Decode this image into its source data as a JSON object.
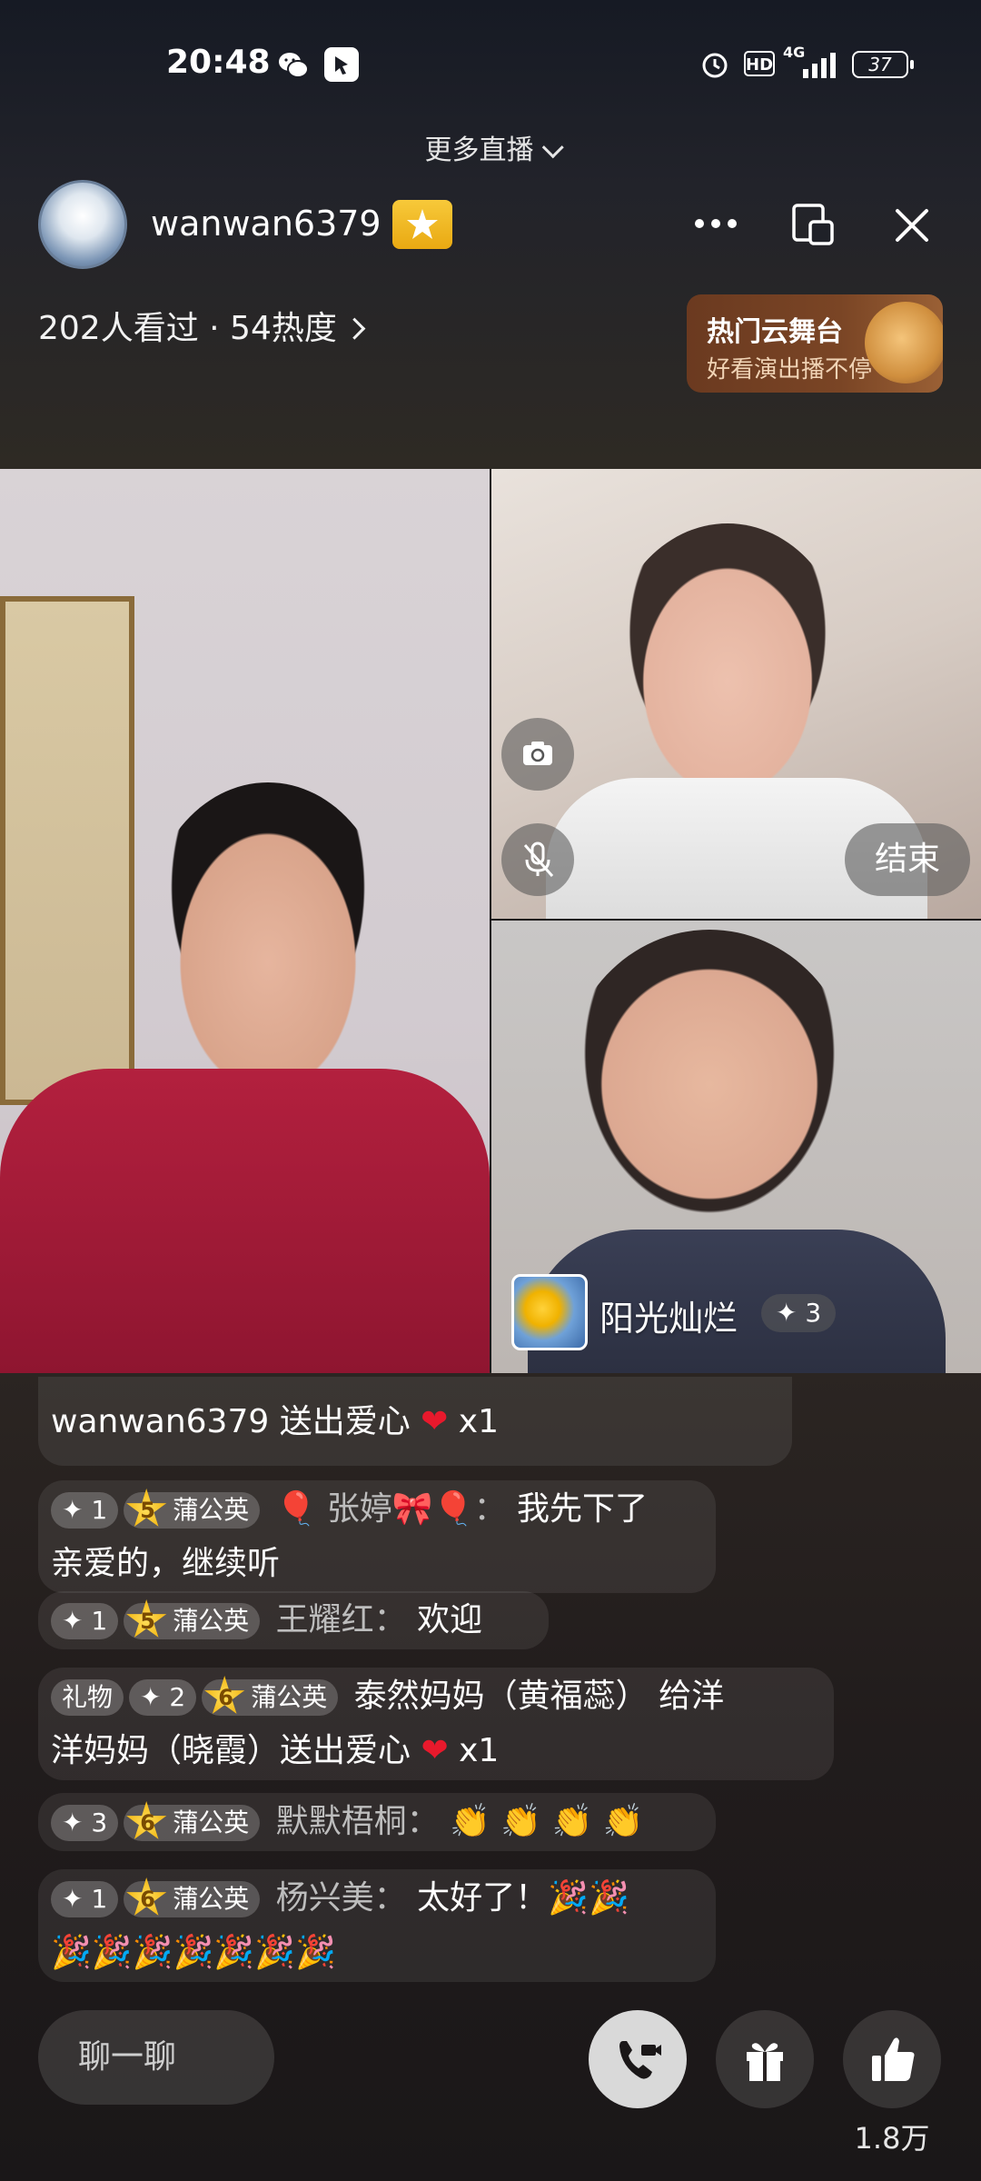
{
  "status_bar": {
    "time": "20:48",
    "hd": "HD",
    "network": "4G",
    "battery": "37"
  },
  "header": {
    "more_live": "更多直播",
    "username": "wanwan6379",
    "stats": "202人看过 · 54热度",
    "promo_title": "热门云舞台",
    "promo_subtitle": "好看演出播不停"
  },
  "video": {
    "end_label": "结束",
    "guest_name": "阳光灿烂",
    "guest_level": "✦ 3"
  },
  "chat": {
    "messages": [
      {
        "text": "wanwan6379 送出爱心",
        "suffix": "x1"
      },
      {
        "badge": "✦ 1",
        "level": "5",
        "club": "蒲公英",
        "nick": "🎈 张婷🎀🎈：",
        "text": "我先下了",
        "text2": "亲爱的，继续听"
      },
      {
        "badge": "✦ 1",
        "level": "5",
        "club": "蒲公英",
        "nick": "王耀红：",
        "text": "欢迎"
      },
      {
        "tag": "礼物",
        "badge": "✦ 2",
        "level": "6",
        "club": "蒲公英",
        "text": "泰然妈妈（黄福蕊） 给洋",
        "text2": "洋妈妈（晓霞）送出爱心",
        "suffix": "x1"
      },
      {
        "badge": "✦ 3",
        "level": "6",
        "club": "蒲公英",
        "nick": "默默梧桐：",
        "text": "👏 👏 👏 👏"
      },
      {
        "badge": "✦ 1",
        "level": "6",
        "club": "蒲公英",
        "nick": "杨兴美：",
        "text": "太好了！🎉🎉",
        "text2": "🎉🎉🎉🎉🎉🎉🎉"
      }
    ]
  },
  "bottom_bar": {
    "chat_placeholder": "聊一聊",
    "like_count": "1.8万"
  },
  "colors": {
    "accent_badge": "#f2b824",
    "heart": "#e8192c"
  }
}
